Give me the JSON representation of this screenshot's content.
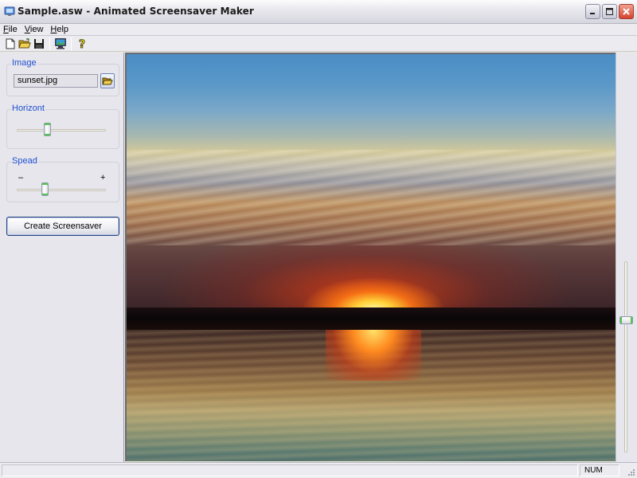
{
  "window": {
    "title": "Sample.asw - Animated Screensaver Maker",
    "controls": [
      "minimize",
      "maximize",
      "close"
    ]
  },
  "menu": {
    "items": [
      {
        "label": "File",
        "accel": "F",
        "rest": "ile"
      },
      {
        "label": "View",
        "accel": "V",
        "rest": "iew"
      },
      {
        "label": "Help",
        "accel": "H",
        "rest": "elp"
      }
    ]
  },
  "toolbar": {
    "buttons": [
      {
        "name": "new",
        "icon": "new-document-icon"
      },
      {
        "name": "open",
        "icon": "open-folder-icon"
      },
      {
        "name": "save",
        "icon": "save-disk-icon"
      },
      {
        "name": "preview",
        "icon": "monitor-preview-icon"
      },
      {
        "name": "help",
        "icon": "help-question-icon"
      }
    ]
  },
  "panel": {
    "image": {
      "label": "Image",
      "file_value": "sunset.jpg"
    },
    "horizont": {
      "label": "Horizont",
      "value_fraction": 0.33
    },
    "speed": {
      "label": "Spead",
      "min_label": "–",
      "max_label": "+",
      "value_fraction": 0.3
    },
    "create_button": "Create Screensaver"
  },
  "preview": {
    "description": "Sunset over water with reflection",
    "vertical_slider_fraction": 0.3
  },
  "status": {
    "main_text": "",
    "num_indicator": "NUM"
  }
}
